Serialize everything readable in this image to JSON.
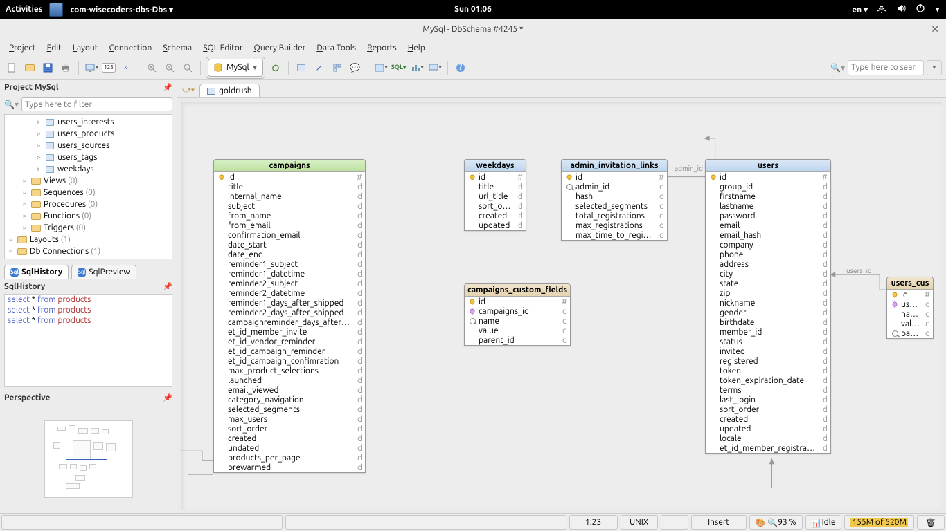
{
  "gnome": {
    "activities": "Activities",
    "app_name": "com-wisecoders-dbs-Dbs",
    "clock": "Sun 01:06",
    "lang": "en"
  },
  "window": {
    "title": "MySql - DbSchema #4245 *"
  },
  "menus": [
    "Project",
    "Edit",
    "Layout",
    "Connection",
    "Schema",
    "SQL Editor",
    "Query Builder",
    "Data Tools",
    "Reports",
    "Help"
  ],
  "combo": {
    "label": "MySql"
  },
  "search_placeholder": "Type here to sear",
  "left": {
    "project_header": "Project MySql",
    "filter_placeholder": "Type here to filter",
    "tree": {
      "tables": [
        "users_interests",
        "users_products",
        "users_sources",
        "users_tags",
        "weekdays"
      ],
      "folders": [
        {
          "label": "Views",
          "count": "(0)"
        },
        {
          "label": "Sequences",
          "count": "(0)"
        },
        {
          "label": "Procedures",
          "count": "(0)"
        },
        {
          "label": "Functions",
          "count": "(0)"
        },
        {
          "label": "Triggers",
          "count": "(0)"
        }
      ],
      "bottom": [
        {
          "label": "Layouts",
          "count": "(1)"
        },
        {
          "label": "Db Connections",
          "count": "(1)"
        }
      ]
    },
    "tabs": {
      "history": "SqlHistory",
      "preview": "SqlPreview"
    },
    "history_header": "SqlHistory",
    "history": [
      {
        "kw": "select",
        "star": "*",
        "from": "from",
        "tbl": "products"
      },
      {
        "kw": "select",
        "star": "*",
        "from": "from",
        "tbl": "products"
      },
      {
        "kw": "select",
        "star": "*",
        "from": "from",
        "tbl": "products"
      }
    ],
    "perspective_header": "Perspective"
  },
  "diagram": {
    "tab_label": "goldrush",
    "rel_labels": {
      "admin_id": "admin_id",
      "users_id": "users_id"
    },
    "tables": {
      "campaigns": {
        "title": "campaigns",
        "cols": [
          "id",
          "title",
          "internal_name",
          "subject",
          "from_name",
          "from_email",
          "confirmation_email",
          "date_start",
          "date_end",
          "reminder1_subject",
          "reminder1_datetime",
          "reminder2_subject",
          "reminder2_datetime",
          "reminder1_days_after_shipped",
          "reminder2_days_after_shipped",
          "campaignreminder_days_after_start",
          "et_id_member_invite",
          "et_id_vendor_reminder",
          "et_id_campaign_reminder",
          "et_id_campaign_confimration",
          "max_product_selections",
          "launched",
          "email_viewed",
          "category_navigation",
          "selected_segments",
          "max_users",
          "sort_order",
          "created",
          "undated",
          "products_per_page",
          "prewarmed"
        ]
      },
      "weekdays": {
        "title": "weekdays",
        "cols": [
          "id",
          "title",
          "url_title",
          "sort_order",
          "created",
          "updated"
        ]
      },
      "admin_invitation_links": {
        "title": "admin_invitation_links",
        "cols": [
          "id",
          "admin_id",
          "hash",
          "selected_segments",
          "total_registrations",
          "max_registrations",
          "max_time_to_register"
        ]
      },
      "users": {
        "title": "users",
        "cols": [
          "id",
          "group_id",
          "firstname",
          "lastname",
          "password",
          "email",
          "email_hash",
          "company",
          "phone",
          "address",
          "city",
          "state",
          "zip",
          "nickname",
          "gender",
          "birthdate",
          "member_id",
          "status",
          "invited",
          "registered",
          "token",
          "token_expiration_date",
          "terms",
          "last_login",
          "sort_order",
          "created",
          "updated",
          "locale",
          "et_id_member_registration"
        ]
      },
      "campaigns_custom_fields": {
        "title": "campaigns_custom_fields",
        "cols": [
          "id",
          "campaigns_id",
          "name",
          "value",
          "parent_id"
        ]
      },
      "users_cus": {
        "title": "users_cus",
        "cols": [
          "id",
          "users_i",
          "name",
          "value",
          "parent_"
        ]
      }
    }
  },
  "status": {
    "pos": "1:23",
    "eol": "UNIX",
    "mode": "Insert",
    "zoom": "93 %",
    "state": "Idle",
    "mem": "155M of 520M"
  }
}
